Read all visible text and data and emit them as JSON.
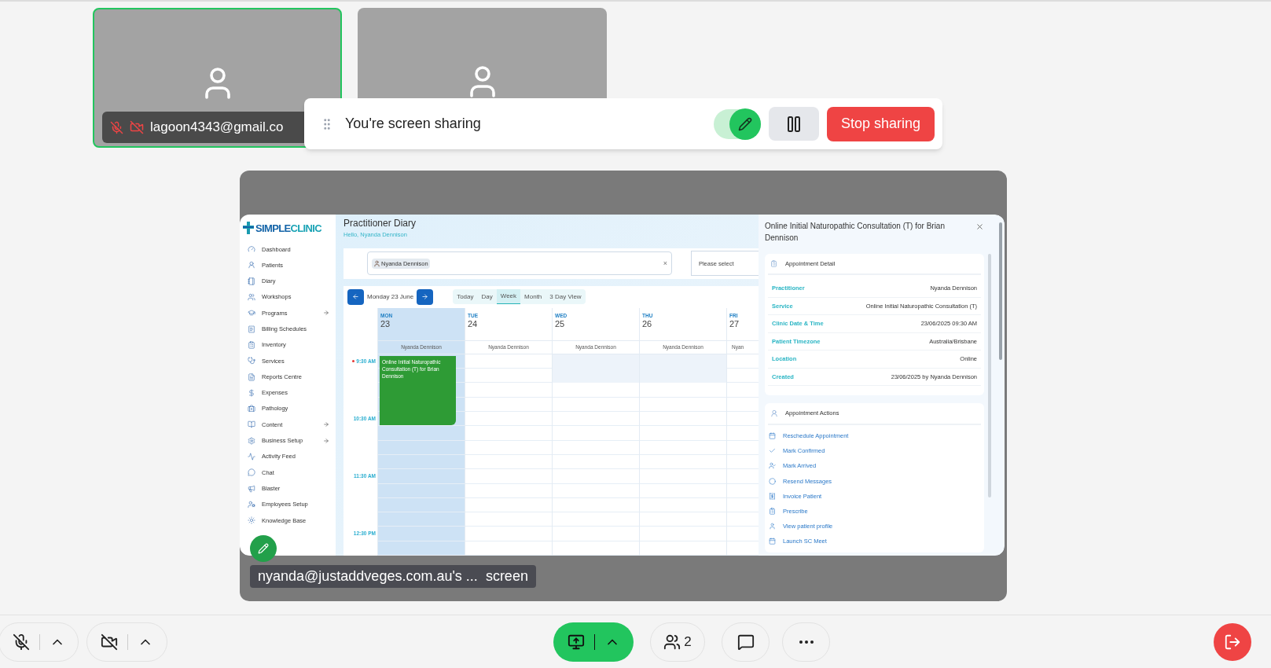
{
  "participants": [
    {
      "name": "lagoon4343@gmail.co",
      "mic_muted": true,
      "camera_off": true,
      "active_speaker": true
    },
    {
      "active_speaker": false
    }
  ],
  "share_banner": {
    "title": "You're screen sharing",
    "annotate_on": true,
    "stop_label": "Stop sharing"
  },
  "shared_screen": {
    "caption": "nyanda@justaddveges.com.au's ...",
    "caption_suffix": "screen",
    "app": {
      "logo": {
        "part_1": "SIMPLE",
        "part_2": "CLINIC"
      },
      "sidebar": [
        {
          "label": "Dashboard",
          "has_submenu": false
        },
        {
          "label": "Patients",
          "has_submenu": false
        },
        {
          "label": "Diary",
          "has_submenu": false
        },
        {
          "label": "Workshops",
          "has_submenu": false
        },
        {
          "label": "Programs",
          "has_submenu": true
        },
        {
          "label": "Billing Schedules",
          "has_submenu": false
        },
        {
          "label": "Inventory",
          "has_submenu": false
        },
        {
          "label": "Services",
          "has_submenu": false
        },
        {
          "label": "Reports Centre",
          "has_submenu": false
        },
        {
          "label": "Expenses",
          "has_submenu": false
        },
        {
          "label": "Pathology",
          "has_submenu": false
        },
        {
          "label": "Content",
          "has_submenu": true
        },
        {
          "label": "Business Setup",
          "has_submenu": true
        },
        {
          "label": "Activity Feed",
          "has_submenu": false
        },
        {
          "label": "Chat",
          "has_submenu": false
        },
        {
          "label": "Blaster",
          "has_submenu": false
        },
        {
          "label": "Employees Setup",
          "has_submenu": false
        },
        {
          "label": "Knowledge Base",
          "has_submenu": false
        }
      ],
      "header": {
        "title": "Practitioner Diary",
        "greeting": "Hello, Nyanda Dennison"
      },
      "filter": {
        "chip": "Nyanda Dennison",
        "clear": "×",
        "select_placeholder": "Please select"
      },
      "calendar": {
        "date": "Monday 23 June",
        "views": [
          {
            "label": "Today",
            "selected": false
          },
          {
            "label": "Day",
            "selected": false
          },
          {
            "label": "Week",
            "selected": true
          },
          {
            "label": "Month",
            "selected": false
          },
          {
            "label": "3 Day View",
            "selected": false
          }
        ],
        "days": [
          {
            "dow": "MON",
            "date": "23",
            "practitioner": "Nyanda Dennison",
            "highlighted": true,
            "blocked": false
          },
          {
            "dow": "TUE",
            "date": "24",
            "practitioner": "Nyanda Dennison",
            "highlighted": false,
            "blocked": false
          },
          {
            "dow": "WED",
            "date": "25",
            "practitioner": "Nyanda Dennison",
            "highlighted": false,
            "blocked": true
          },
          {
            "dow": "THU",
            "date": "26",
            "practitioner": "Nyanda Dennison",
            "highlighted": false,
            "blocked": true
          },
          {
            "dow": "FRI",
            "date": "27",
            "practitioner": "Nyan",
            "highlighted": false,
            "blocked": false
          }
        ],
        "times": [
          {
            "label": "9:30 AM",
            "current": true
          },
          {
            "label": "10:30 AM",
            "current": false
          },
          {
            "label": "11:30 AM",
            "current": false
          },
          {
            "label": "12:30 PM",
            "current": false
          }
        ],
        "event": {
          "title": "Online Initial Naturopathic Consultation (T) for Brian Dennison"
        }
      },
      "detail": {
        "title": "Online Initial Naturopathic Consultation (T) for Brian Dennison",
        "detail_heading": "Appointment Detail",
        "rows": [
          {
            "label": "Practitioner",
            "value": "Nyanda Dennison"
          },
          {
            "label": "Service",
            "value": "Online Initial Naturopathic Consultation (T)"
          },
          {
            "label": "Clinic Date & Time",
            "value": "23/06/2025 09:30 AM"
          },
          {
            "label": "Patient Timezone",
            "value": "Australia/Brisbane"
          },
          {
            "label": "Location",
            "value": "Online"
          },
          {
            "label": "Created",
            "value": "23/06/2025 by Nyanda Dennison"
          }
        ],
        "actions_heading": "Appointment Actions",
        "actions": [
          "Reschedule Appointment",
          "Mark Confirmed",
          "Mark Arrived",
          "Resend Messages",
          "Invoice Patient",
          "Prescribe",
          "View patient profile",
          "Launch SC Meet"
        ]
      }
    }
  },
  "toolbar": {
    "mic_muted": true,
    "camera_off": true,
    "sharing": true,
    "participant_count": "2"
  }
}
